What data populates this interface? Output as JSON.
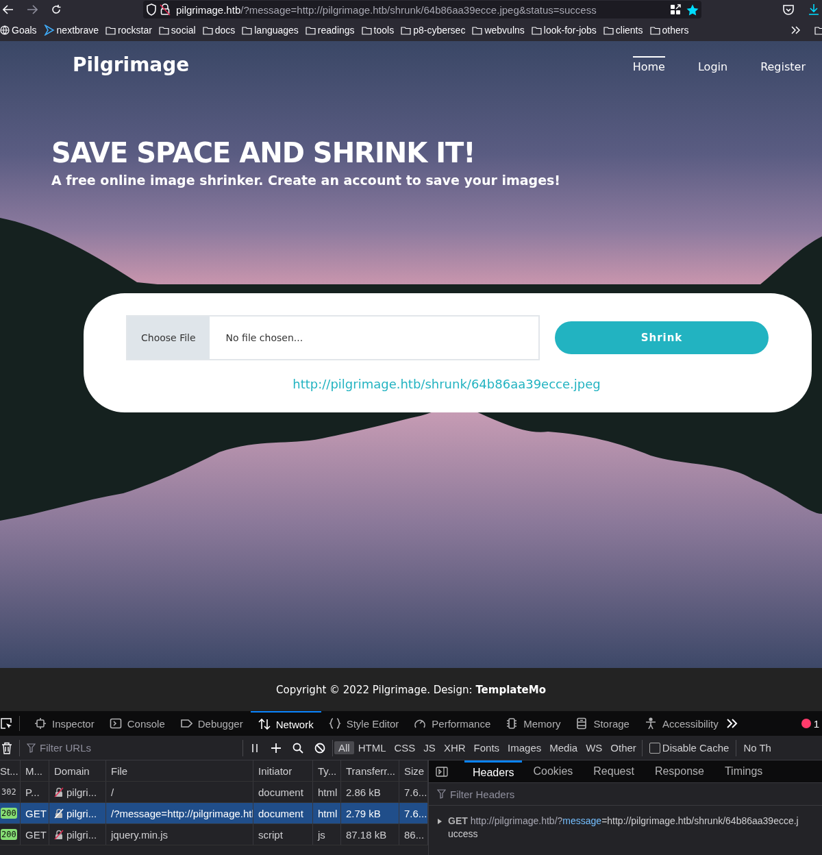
{
  "browser": {
    "url": {
      "host": "pilgrimage.htb",
      "rest": "/?message=http://pilgrimage.htb/shrunk/64b86aa39ecce.jpeg&status=success"
    },
    "bookmarks": [
      {
        "label": "Goals",
        "kind": "globe"
      },
      {
        "label": "nextbrave",
        "kind": "chevron"
      },
      {
        "label": "rockstar",
        "kind": "folder"
      },
      {
        "label": "social",
        "kind": "folder"
      },
      {
        "label": "docs",
        "kind": "folder"
      },
      {
        "label": "languages",
        "kind": "folder"
      },
      {
        "label": "readings",
        "kind": "folder"
      },
      {
        "label": "tools",
        "kind": "folder"
      },
      {
        "label": "p8-cybersec",
        "kind": "folder"
      },
      {
        "label": "webvulns",
        "kind": "folder"
      },
      {
        "label": "look-for-jobs",
        "kind": "folder"
      },
      {
        "label": "clients",
        "kind": "folder"
      },
      {
        "label": "others",
        "kind": "folder"
      }
    ]
  },
  "site": {
    "logo": "Pilgrimage",
    "nav": [
      {
        "label": "Home",
        "selected": true
      },
      {
        "label": "Login",
        "selected": false
      },
      {
        "label": "Register",
        "selected": false
      }
    ],
    "headline": "SAVE SPACE AND SHRINK IT!",
    "subheadline": "A free online image shrinker. Create an account to save your images!",
    "upload": {
      "button": "Choose File",
      "placeholder": "No file chosen...",
      "submit": "Shrink"
    },
    "result_link": "http://pilgrimage.htb/shrunk/64b86aa39ecce.jpeg",
    "footer": "Copyright © 2022 Pilgrimage. Design: **TemplateMo**"
  },
  "devtools": {
    "tools": [
      {
        "label": "Inspector",
        "selected": false
      },
      {
        "label": "Console",
        "selected": false
      },
      {
        "label": "Debugger",
        "selected": false
      },
      {
        "label": "Network",
        "selected": true
      },
      {
        "label": "Style Editor",
        "selected": false
      },
      {
        "label": "Performance",
        "selected": false
      },
      {
        "label": "Memory",
        "selected": false
      },
      {
        "label": "Storage",
        "selected": false
      },
      {
        "label": "Accessibility",
        "selected": false
      }
    ],
    "error_count": "1",
    "filter_placeholder": "Filter URLs",
    "type_filters": [
      {
        "label": "All",
        "selected": true
      },
      {
        "label": "HTML",
        "selected": false
      },
      {
        "label": "CSS",
        "selected": false
      },
      {
        "label": "JS",
        "selected": false
      },
      {
        "label": "XHR",
        "selected": false
      },
      {
        "label": "Fonts",
        "selected": false
      },
      {
        "label": "Images",
        "selected": false
      },
      {
        "label": "Media",
        "selected": false
      },
      {
        "label": "WS",
        "selected": false
      },
      {
        "label": "Other",
        "selected": false
      }
    ],
    "disable_cache": {
      "label": "Disable Cache",
      "checked": false
    },
    "throttle": "No Th",
    "columns": [
      "St...",
      "M...",
      "Domain",
      "File",
      "Initiator",
      "Ty...",
      "Transferr...",
      "Size"
    ],
    "rows": [
      {
        "status": "302",
        "status_ok": false,
        "method": "P...",
        "domain": "pilgri...",
        "file": "/",
        "initiator": "document",
        "type": "html",
        "transferred": "2.86 kB",
        "size": "7.6...",
        "selected": false
      },
      {
        "status": "200",
        "status_ok": true,
        "method": "GET",
        "domain": "pilgri...",
        "file": "/?message=http://pilgrimage.htl",
        "initiator": "document",
        "type": "html",
        "transferred": "2.79 kB",
        "size": "7.6...",
        "selected": true
      },
      {
        "status": "200",
        "status_ok": true,
        "method": "GET",
        "domain": "pilgri...",
        "file": "jquery.min.js",
        "initiator": "script",
        "type": "js",
        "transferred": "87.18 kB",
        "size": "86...",
        "selected": false
      }
    ],
    "detail_tabs": [
      {
        "label": "Headers",
        "selected": true
      },
      {
        "label": "Cookies",
        "selected": false
      },
      {
        "label": "Request",
        "selected": false
      },
      {
        "label": "Response",
        "selected": false
      },
      {
        "label": "Timings",
        "selected": false
      }
    ],
    "filter_headers_placeholder": "Filter Headers",
    "request_line": {
      "method": "GET",
      "url_prefix": "http://pilgrimage.htb/?",
      "param": "message",
      "url_rest": "=http://pilgrimage.htb/shrunk/64b86aa39ecce.j",
      "wrap": "uccess"
    }
  }
}
